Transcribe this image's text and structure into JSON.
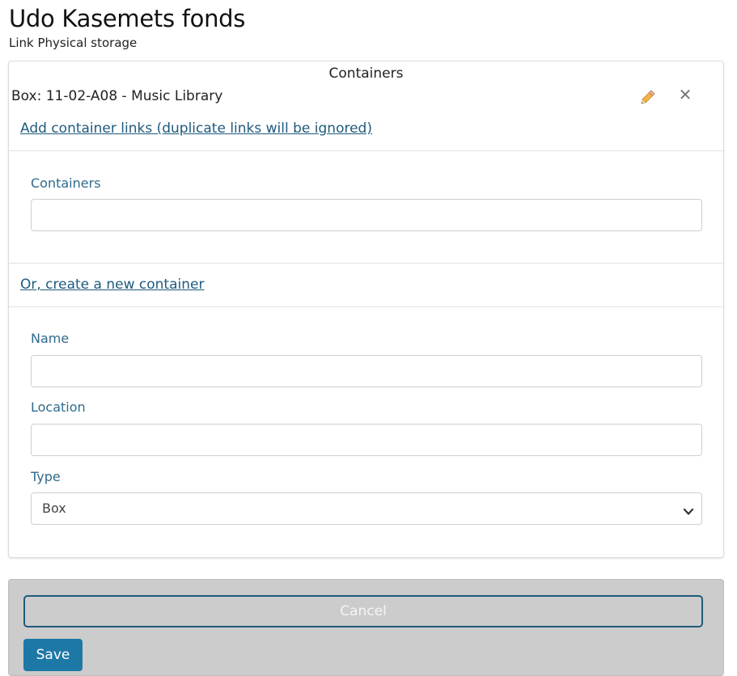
{
  "header": {
    "title": "Udo Kasemets fonds",
    "subtitle": "Link Physical storage"
  },
  "containers_panel": {
    "heading": "Containers",
    "items": [
      {
        "label": "Box: 11-02-A08 - Music Library"
      }
    ],
    "edit_icon": "pencil-icon",
    "remove_icon": "close-icon",
    "remove_glyph": "✕",
    "add_link_text": "Add container links (duplicate links will be ignored)",
    "containers_field": {
      "label": "Containers",
      "value": "",
      "placeholder": ""
    },
    "create_link_text": "Or, create a new container",
    "name_field": {
      "label": "Name",
      "value": "",
      "placeholder": ""
    },
    "location_field": {
      "label": "Location",
      "value": "",
      "placeholder": ""
    },
    "type_field": {
      "label": "Type",
      "selected": "Box",
      "chevron_icon": "chevron-down-icon"
    }
  },
  "actions": {
    "cancel_label": "Cancel",
    "save_label": "Save"
  },
  "colors": {
    "link": "#1f5a7d",
    "label": "#2f6b8c",
    "primary": "#1e78a6",
    "footer_bg": "#cccccc"
  }
}
